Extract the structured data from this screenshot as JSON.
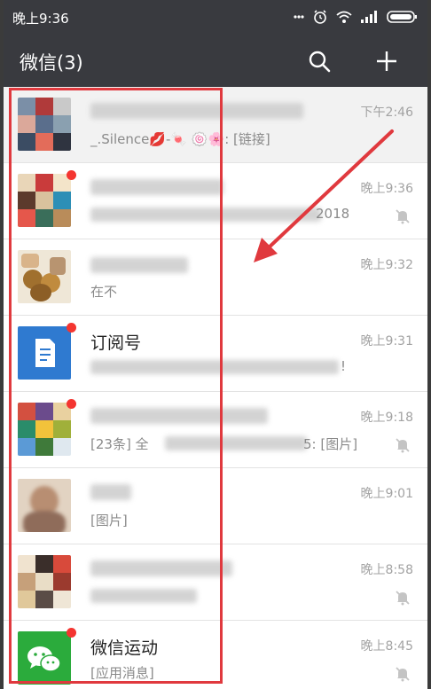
{
  "status": {
    "time": "晚上9:36"
  },
  "header": {
    "title": "微信(3)"
  },
  "chats": [
    {
      "name": "",
      "preview": "_.Silence💋-🍬 🍥🌸: [链接]",
      "time": "下午2:46"
    },
    {
      "name": "",
      "preview": "2018",
      "time": "晚上9:36"
    },
    {
      "name": "",
      "preview": "在不",
      "time": "晚上9:32"
    },
    {
      "name": "订阅号",
      "preview": "!",
      "time": "晚上9:31"
    },
    {
      "name": "",
      "preview": "[23条] 全",
      "preview2": "5: [图片]",
      "time": "晚上9:18"
    },
    {
      "name": "",
      "preview": "[图片]",
      "time": "晚上9:01"
    },
    {
      "name": "",
      "preview": "",
      "time": "晚上8:58"
    },
    {
      "name": "微信运动",
      "preview": "[应用消息]",
      "time": "晚上8:45"
    }
  ],
  "colors": {
    "header_bg": "#393a3f",
    "badge": "#f43530",
    "annotation": "#e0393e"
  }
}
